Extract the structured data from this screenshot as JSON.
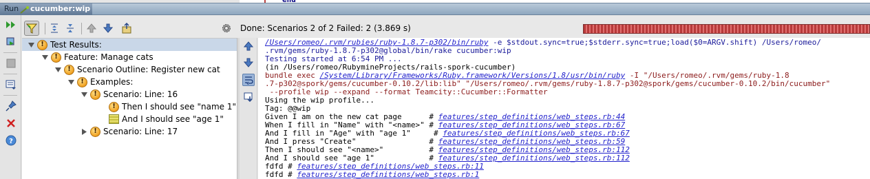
{
  "editor": {
    "keyword": "end"
  },
  "title_bar": {
    "run_label": "Run",
    "config_name": "cucumber:wip"
  },
  "side_toolbar": {
    "icons": [
      "rerun-icon",
      "toggle-autotest-icon",
      "stop-icon",
      "dump-threads-icon",
      "pin-icon",
      "close-icon",
      "help-icon"
    ]
  },
  "tree_toolbar": {
    "icons": [
      "hide-passed-icon",
      "expand-all-icon",
      "collapse-all-icon",
      "previous-failure-icon",
      "next-failure-icon",
      "export-icon"
    ]
  },
  "status": {
    "text": "Done: Scenarios 2 of 2  Failed: 2  (3.869 s)",
    "progress_fraction": 1.0,
    "progress_color": "#c0392b"
  },
  "tree": {
    "items": [
      {
        "label": "Test Results:",
        "status": "warning",
        "expanded": true,
        "selected": true
      },
      {
        "label": "Feature: Manage cats",
        "status": "warning",
        "expanded": true
      },
      {
        "label": "Scenario Outline: Register new cat",
        "status": "warning",
        "expanded": true
      },
      {
        "label": "Examples:",
        "status": "warning",
        "expanded": true
      },
      {
        "label": "Scenario: Line: 16",
        "status": "warning",
        "expanded": true
      },
      {
        "label": "Then I should see \"name 1\"",
        "status": "warning"
      },
      {
        "label": "And I should see \"age 1\"",
        "status": "passed"
      },
      {
        "label": "Scenario: Line: 17",
        "status": "warning",
        "expanded": false
      }
    ]
  },
  "console_toolbar": {
    "icons": [
      "scroll-up-icon",
      "scroll-down-icon",
      "soft-wrap-icon",
      "scroll-to-end-icon"
    ]
  },
  "console": {
    "cmd_link_1": "/Users/romeo/.rvm/rubies/ruby-1.8.7-p302/bin/ruby",
    "cmd_rest_1": " -e $stdout.sync=true;$stderr.sync=true;load($0=ARGV.shift) /Users/romeo/",
    "cmd_line_2": ".rvm/gems/ruby-1.8.7-p302@global/bin/rake cucumber:wip",
    "started": "Testing started at 6:54 PM ...",
    "cwd": "(in /Users/romeo/RubymineProjects/rails-spork-cucumber)",
    "bundle_prefix": "bundle exec ",
    "bundle_link": "/System/Library/Frameworks/Ruby.framework/Versions/1.8/usr/bin/ruby",
    "bundle_rest_1": " -I \"/Users/romeo/.rvm/gems/ruby-1.8",
    "bundle_line_2": ".7-p302@spork/gems/cucumber-0.10.2/lib:lib\" \"/Users/romeo/.rvm/gems/ruby-1.8.7-p302@spork/gems/cucumber-0.10.2/bin/cucumber\"",
    "bundle_line_3": " --profile wip --expand --format Teamcity::Cucumber::Formatter",
    "profile": "Using the wip profile...",
    "tag": "Tag: @@wip",
    "steps": [
      {
        "text": "Given I am on the new cat page      # ",
        "link": "features/step_definitions/web_steps.rb:44"
      },
      {
        "text": "When I fill in \"Name\" with \"<name>\" # ",
        "link": "features/step_definitions/web_steps.rb:67"
      },
      {
        "text": "And I fill in \"Age\" with \"age 1\"     # ",
        "link": "features/step_definitions/web_steps.rb:67"
      },
      {
        "text": "And I press \"Create\"                # ",
        "link": "features/step_definitions/web_steps.rb:59"
      },
      {
        "text": "Then I should see \"<name>\"          # ",
        "link": "features/step_definitions/web_steps.rb:112"
      },
      {
        "text": "And I should see \"age 1\"            # ",
        "link": "features/step_definitions/web_steps.rb:112"
      },
      {
        "text": "fdfd # ",
        "link": "features/step_definitions/web_steps.rb:11"
      },
      {
        "text": "fdfd # ",
        "link": "features/step_definitions/web_steps.rb:1"
      }
    ]
  }
}
